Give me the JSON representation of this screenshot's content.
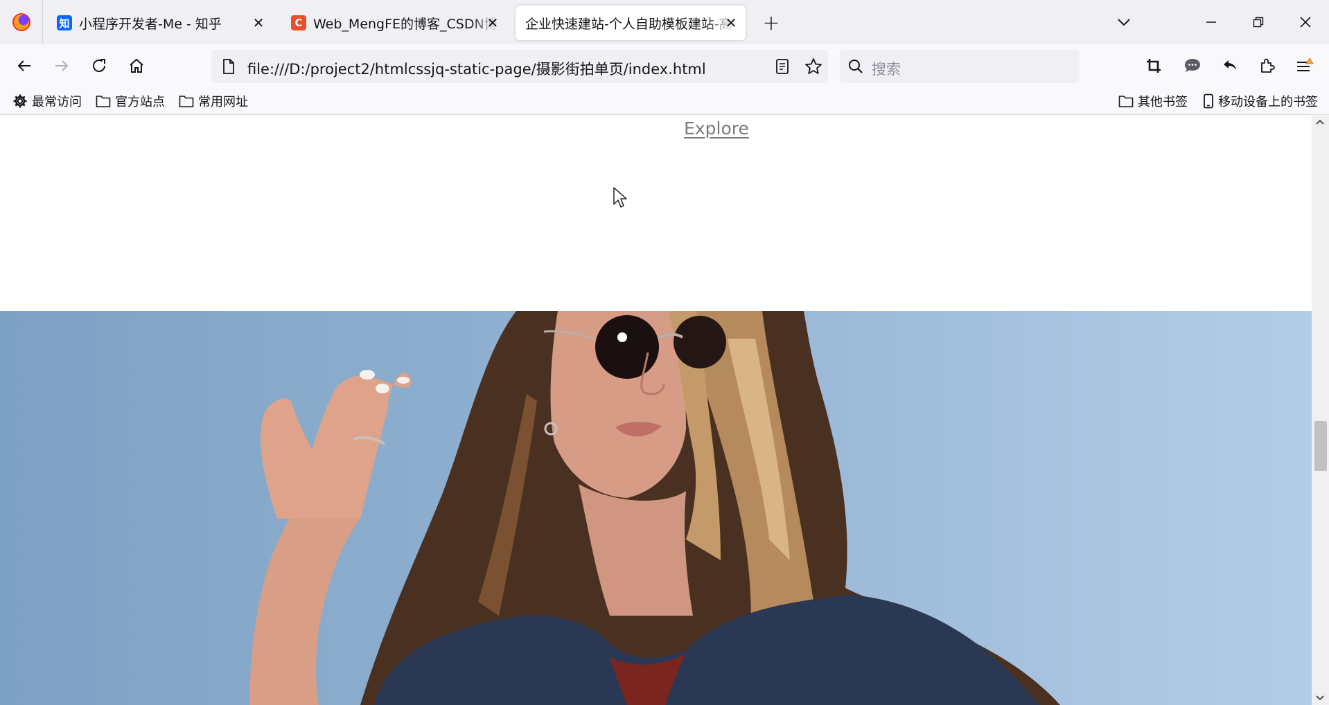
{
  "tabs": [
    {
      "title": "小程序开发者-Me - 知乎",
      "favicon_text": "知",
      "favicon_color": "#0a66ff",
      "active": false
    },
    {
      "title": "Web_MengFE的博客_CSDN博客",
      "favicon_text": "C",
      "favicon_color": "#e8502c",
      "active": false
    },
    {
      "title": "企业快速建站-个人自助模板建站-高",
      "active": true
    }
  ],
  "navbar": {
    "url": "file:///D:/project2/htmlcssjq-static-page/摄影街拍单页/index.html",
    "search_placeholder": "搜索"
  },
  "bookmarks": {
    "left": [
      {
        "label": "最常访问",
        "icon": "gear-icon"
      },
      {
        "label": "官方站点",
        "icon": "folder-icon"
      },
      {
        "label": "常用网址",
        "icon": "folder-icon"
      }
    ],
    "right": [
      {
        "label": "其他书签",
        "icon": "folder-icon"
      },
      {
        "label": "移动设备上的书签",
        "icon": "mobile-icon"
      }
    ]
  },
  "page": {
    "link_text": "Explore"
  },
  "scroll": {
    "position_fraction": 0.57
  }
}
